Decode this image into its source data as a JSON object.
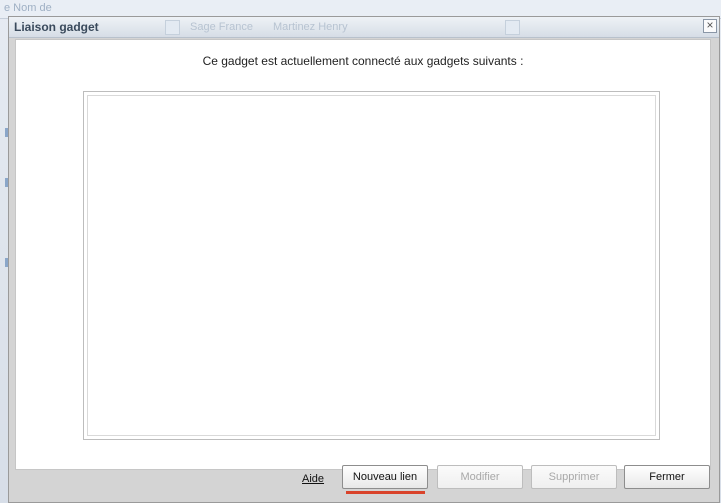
{
  "background": {
    "row_text_1": "e Nom de",
    "row_text_2": "Sage France",
    "row_text_3": "Martinez Henry"
  },
  "dialog": {
    "title": "Liaison gadget",
    "close_label": "×",
    "heading": "Ce gadget est actuellement connecté aux gadgets suivants :",
    "connected_gadgets": []
  },
  "buttons": {
    "help_label": "Aide",
    "new_link_label": "Nouveau lien",
    "modify_label": "Modifier",
    "delete_label": "Supprimer",
    "close_label": "Fermer"
  },
  "colors": {
    "accent_underline": "#d9432b",
    "title_text": "#3a4a5c"
  }
}
